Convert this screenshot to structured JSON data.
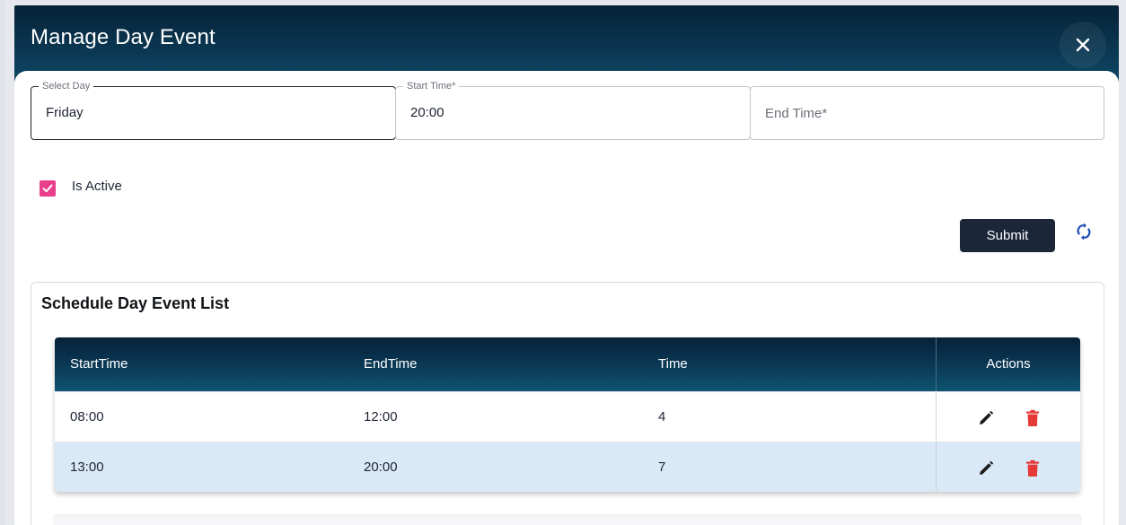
{
  "dialog": {
    "title": "Manage Day Event",
    "close_icon": "close-icon"
  },
  "form": {
    "select_day": {
      "label": "Select Day",
      "value": "Friday"
    },
    "start_time": {
      "label": "Start Time*",
      "value": "20:00"
    },
    "end_time": {
      "placeholder": "End Time*",
      "value": ""
    },
    "is_active": {
      "label": "Is Active",
      "checked": true
    },
    "submit_label": "Submit",
    "refresh_icon": "refresh-icon"
  },
  "list": {
    "title": "Schedule Day Event List",
    "columns": [
      "StartTime",
      "EndTime",
      "Time",
      "Actions"
    ],
    "rows": [
      {
        "start": "08:00",
        "end": "12:00",
        "time": "4"
      },
      {
        "start": "13:00",
        "end": "20:00",
        "time": "7"
      }
    ],
    "action_icons": [
      "edit-icon",
      "delete-icon"
    ]
  },
  "colors": {
    "header_dark": "#062238",
    "header_light": "#0f5472",
    "checkbox": "#e83e8c",
    "delete": "#e53935",
    "alt_row": "#d9e9f7",
    "submit_bg": "#1b2639"
  }
}
